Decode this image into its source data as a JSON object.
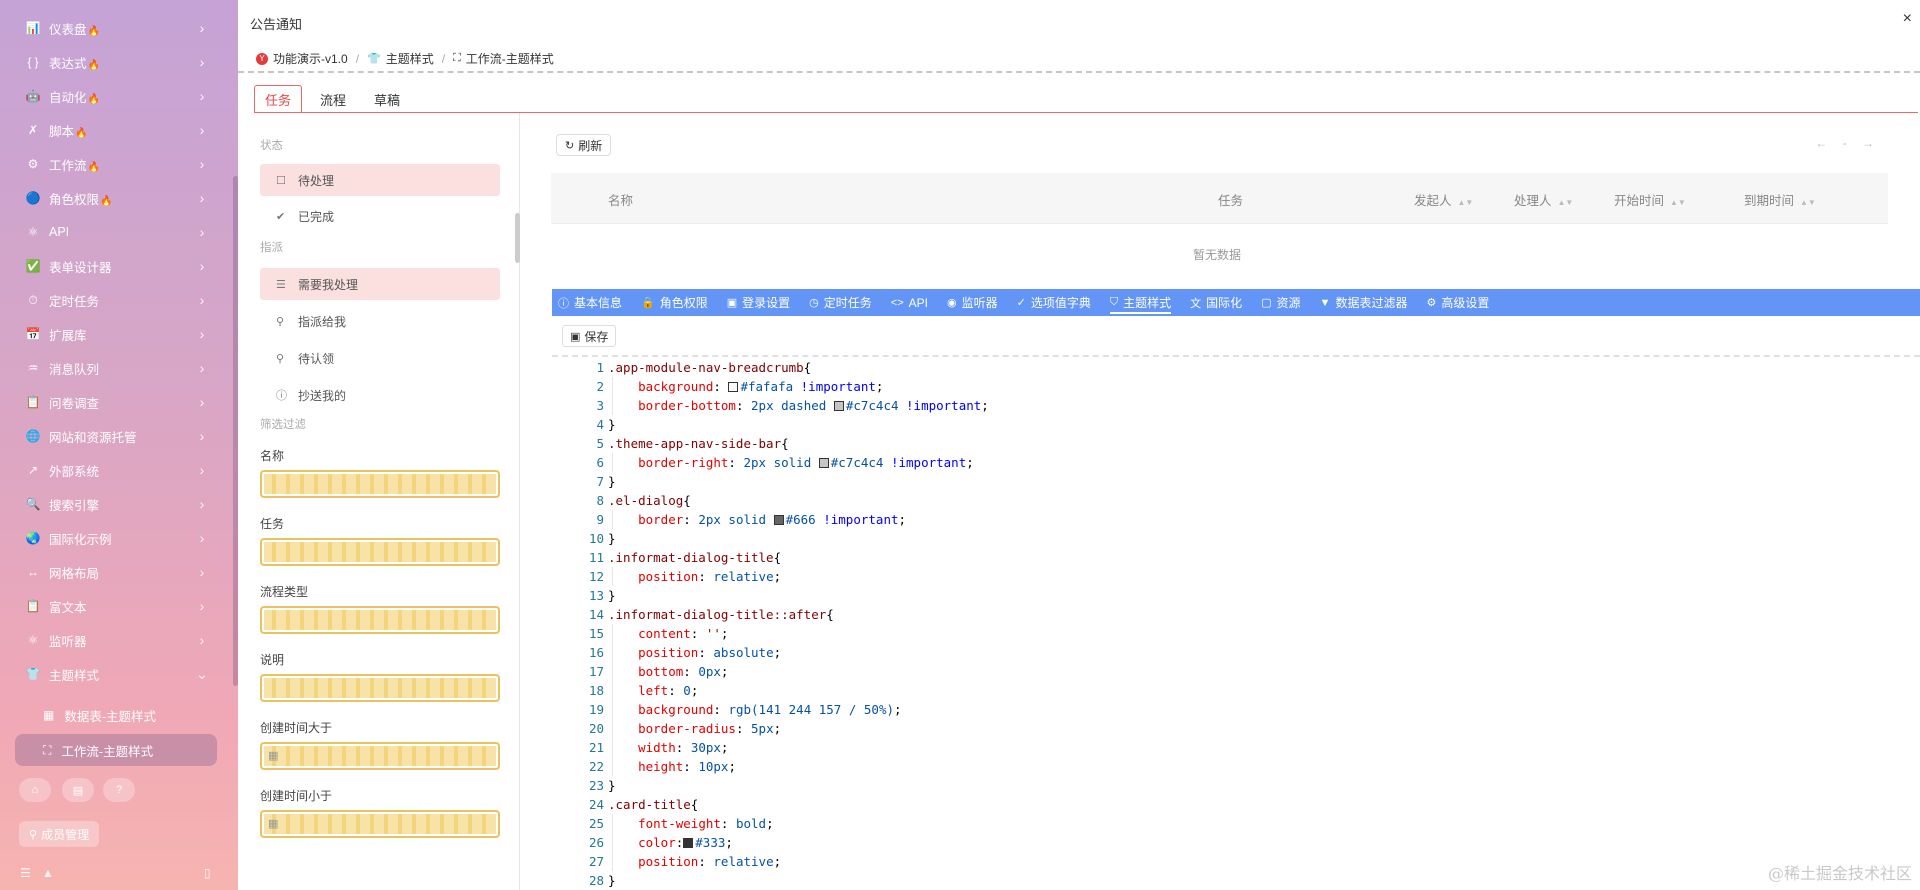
{
  "sidebar": {
    "items": [
      {
        "label": "仪表盘",
        "icon": "📊",
        "fire": true
      },
      {
        "label": "表达式",
        "icon": "{ }",
        "fire": true
      },
      {
        "label": "自动化",
        "icon": "🤖",
        "fire": true
      },
      {
        "label": "脚本",
        "icon": "✗",
        "fire": true
      },
      {
        "label": "工作流",
        "icon": "⚙",
        "fire": true
      },
      {
        "label": "角色权限",
        "icon": "🔵",
        "fire": true
      },
      {
        "label": "API",
        "icon": "⚛",
        "fire": false
      },
      {
        "label": "表单设计器",
        "icon": "✅",
        "fire": false
      },
      {
        "label": "定时任务",
        "icon": "⏱",
        "fire": false
      },
      {
        "label": "扩展库",
        "icon": "📅",
        "fire": false
      },
      {
        "label": "消息队列",
        "icon": "♒",
        "fire": false
      },
      {
        "label": "问卷调查",
        "icon": "📋",
        "fire": false
      },
      {
        "label": "网站和资源托管",
        "icon": "🌐",
        "fire": false
      },
      {
        "label": "外部系统",
        "icon": "↗",
        "fire": false
      },
      {
        "label": "搜索引擎",
        "icon": "🔍",
        "fire": false
      },
      {
        "label": "国际化示例",
        "icon": "🌏",
        "fire": false
      },
      {
        "label": "网格布局",
        "icon": "↔",
        "fire": false
      },
      {
        "label": "富文本",
        "icon": "📋",
        "fire": false
      },
      {
        "label": "监听器",
        "icon": "⚛",
        "fire": false
      },
      {
        "label": "主题样式",
        "icon": "👕",
        "fire": false,
        "expanded": true
      }
    ],
    "sub_items": [
      {
        "label": "数据表-主题样式",
        "icon": "▦"
      },
      {
        "label": "工作流-主题样式",
        "icon": "⛶",
        "active": true
      }
    ],
    "member_button": "成员管理",
    "fire_icon": "🔥"
  },
  "header": {
    "title": "公告通知",
    "close": "×",
    "breadcrumb": [
      {
        "label": "功能演示-v1.0",
        "icon": "Y"
      },
      {
        "label": "主题样式",
        "icon": "👕"
      },
      {
        "label": "工作流-主题样式",
        "icon": "⛶"
      }
    ]
  },
  "tabs": [
    "任务",
    "流程",
    "草稿"
  ],
  "filter": {
    "status_section": "状态",
    "status_items": [
      {
        "label": "待处理",
        "icon": "☐",
        "active": true
      },
      {
        "label": "已完成",
        "icon": "✔"
      }
    ],
    "assign_section": "指派",
    "assign_items": [
      {
        "label": "需要我处理",
        "icon": "☰",
        "active": true
      },
      {
        "label": "指派给我",
        "icon": "⚲"
      },
      {
        "label": "待认领",
        "icon": "⚲"
      },
      {
        "label": "抄送我的",
        "icon": "ⓘ"
      }
    ],
    "filter_section": "筛选过滤",
    "fields": [
      "名称",
      "任务",
      "流程类型",
      "说明",
      "创建时间大于",
      "创建时间小于"
    ]
  },
  "task_table": {
    "refresh": "刷新",
    "pager": "← - →",
    "columns": [
      "名称",
      "任务",
      "发起人",
      "处理人",
      "开始时间",
      "到期时间"
    ],
    "empty_text": "暂无数据"
  },
  "config": {
    "tabs": [
      {
        "label": "基本信息",
        "icon": "ⓘ"
      },
      {
        "label": "角色权限",
        "icon": "🔒"
      },
      {
        "label": "登录设置",
        "icon": "▣"
      },
      {
        "label": "定时任务",
        "icon": "◷"
      },
      {
        "label": "API",
        "icon": "<>"
      },
      {
        "label": "监听器",
        "icon": "◉"
      },
      {
        "label": "选项值字典",
        "icon": "✓"
      },
      {
        "label": "主题样式",
        "icon": "⛉",
        "active": true
      },
      {
        "label": "国际化",
        "icon": "文"
      },
      {
        "label": "资源",
        "icon": "▢"
      },
      {
        "label": "数据表过滤器",
        "icon": "▼"
      },
      {
        "label": "高级设置",
        "icon": "⚙"
      }
    ],
    "save": "保存"
  },
  "code_lines": [
    [
      [
        "sel",
        ".app-module-nav-breadcrumb"
      ],
      [
        "punc",
        "{"
      ]
    ],
    [
      [
        "ind",
        ""
      ],
      [
        "prop",
        "background"
      ],
      [
        "punc",
        ": "
      ],
      [
        "sw",
        "#fafafa"
      ],
      [
        "val",
        "#fafafa"
      ],
      [
        "punc",
        " "
      ],
      [
        "imp",
        "!important"
      ],
      [
        "punc",
        ";"
      ]
    ],
    [
      [
        "ind",
        ""
      ],
      [
        "prop",
        "border-bottom"
      ],
      [
        "punc",
        ": "
      ],
      [
        "val",
        "2px dashed "
      ],
      [
        "sw",
        "#c7c4c4"
      ],
      [
        "val",
        "#c7c4c4"
      ],
      [
        "punc",
        " "
      ],
      [
        "imp",
        "!important"
      ],
      [
        "punc",
        ";"
      ]
    ],
    [
      [
        "punc",
        "}"
      ]
    ],
    [
      [
        "sel",
        ".theme-app-nav-side-bar"
      ],
      [
        "punc",
        "{"
      ]
    ],
    [
      [
        "ind",
        ""
      ],
      [
        "prop",
        "border-right"
      ],
      [
        "punc",
        ": "
      ],
      [
        "val",
        "2px solid "
      ],
      [
        "sw",
        "#c7c4c4"
      ],
      [
        "val",
        "#c7c4c4"
      ],
      [
        "punc",
        " "
      ],
      [
        "imp",
        "!important"
      ],
      [
        "punc",
        ";"
      ]
    ],
    [
      [
        "punc",
        "}"
      ]
    ],
    [
      [
        "sel",
        ".el-dialog"
      ],
      [
        "punc",
        "{"
      ]
    ],
    [
      [
        "ind",
        ""
      ],
      [
        "prop",
        "border"
      ],
      [
        "punc",
        ": "
      ],
      [
        "val",
        "2px solid "
      ],
      [
        "sw",
        "#666"
      ],
      [
        "val",
        "#666"
      ],
      [
        "punc",
        " "
      ],
      [
        "imp",
        "!important"
      ],
      [
        "punc",
        ";"
      ]
    ],
    [
      [
        "punc",
        "}"
      ]
    ],
    [
      [
        "sel",
        ".informat-dialog-title"
      ],
      [
        "punc",
        "{"
      ]
    ],
    [
      [
        "ind",
        ""
      ],
      [
        "prop",
        "position"
      ],
      [
        "punc",
        ": "
      ],
      [
        "val",
        "relative"
      ],
      [
        "punc",
        ";"
      ]
    ],
    [
      [
        "punc",
        "}"
      ]
    ],
    [
      [
        "sel",
        ".informat-dialog-title::after"
      ],
      [
        "punc",
        "{"
      ]
    ],
    [
      [
        "ind",
        ""
      ],
      [
        "prop",
        "content"
      ],
      [
        "punc",
        ": "
      ],
      [
        "sel",
        "''"
      ],
      [
        "punc",
        ";"
      ]
    ],
    [
      [
        "ind",
        ""
      ],
      [
        "prop",
        "position"
      ],
      [
        "punc",
        ": "
      ],
      [
        "val",
        "absolute"
      ],
      [
        "punc",
        ";"
      ]
    ],
    [
      [
        "ind",
        ""
      ],
      [
        "prop",
        "bottom"
      ],
      [
        "punc",
        ": "
      ],
      [
        "val",
        "0px"
      ],
      [
        "punc",
        ";"
      ]
    ],
    [
      [
        "ind",
        ""
      ],
      [
        "prop",
        "left"
      ],
      [
        "punc",
        ": "
      ],
      [
        "val",
        "0"
      ],
      [
        "punc",
        ";"
      ]
    ],
    [
      [
        "ind",
        ""
      ],
      [
        "prop",
        "background"
      ],
      [
        "punc",
        ": "
      ],
      [
        "val",
        "rgb(141 244 157 / 50%)"
      ],
      [
        "punc",
        ";"
      ]
    ],
    [
      [
        "ind",
        ""
      ],
      [
        "prop",
        "border-radius"
      ],
      [
        "punc",
        ": "
      ],
      [
        "val",
        "5px"
      ],
      [
        "punc",
        ";"
      ]
    ],
    [
      [
        "ind",
        ""
      ],
      [
        "prop",
        "width"
      ],
      [
        "punc",
        ": "
      ],
      [
        "val",
        "30px"
      ],
      [
        "punc",
        ";"
      ]
    ],
    [
      [
        "ind",
        ""
      ],
      [
        "prop",
        "height"
      ],
      [
        "punc",
        ": "
      ],
      [
        "val",
        "10px"
      ],
      [
        "punc",
        ";"
      ]
    ],
    [
      [
        "punc",
        "}"
      ]
    ],
    [
      [
        "sel",
        ".card-title"
      ],
      [
        "punc",
        "{"
      ]
    ],
    [
      [
        "ind",
        ""
      ],
      [
        "prop",
        "font-weight"
      ],
      [
        "punc",
        ": "
      ],
      [
        "val",
        "bold"
      ],
      [
        "punc",
        ";"
      ]
    ],
    [
      [
        "ind",
        ""
      ],
      [
        "prop",
        "color"
      ],
      [
        "punc",
        ":"
      ],
      [
        "sw",
        "#333"
      ],
      [
        "val",
        "#333"
      ],
      [
        "punc",
        ";"
      ]
    ],
    [
      [
        "ind",
        ""
      ],
      [
        "prop",
        "position"
      ],
      [
        "punc",
        ": "
      ],
      [
        "val",
        "relative"
      ],
      [
        "punc",
        ";"
      ]
    ],
    [
      [
        "punc",
        "}"
      ]
    ]
  ],
  "watermark": "@稀土掘金技术社区",
  "colors": {
    "accent_red": "#e44444",
    "config_bar": "#6395f7",
    "active_filter_bg": "#fbe0e0"
  }
}
